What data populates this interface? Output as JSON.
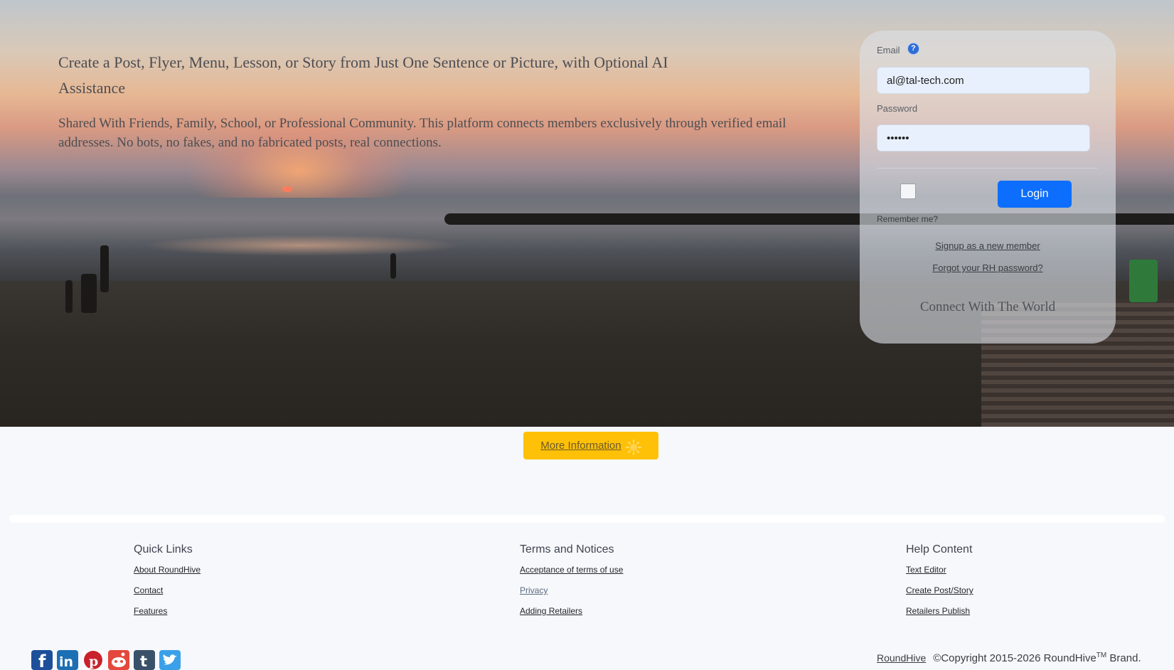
{
  "hero": {
    "title": "Create a Post, Flyer, Menu, Lesson, or Story from Just One Sentence or Picture, with Optional AI Assistance",
    "subtitle": "Shared With Friends, Family, School, or Professional Community. This platform connects members exclusively through verified email addresses. No bots, no fakes, and no fabricated posts, real connections."
  },
  "login": {
    "email_label": "Email",
    "email_help_icon": "help-icon",
    "email_value": "al@tal-tech.com",
    "password_label": "Password",
    "password_value": "••••••",
    "remember_label": "Remember me?",
    "remember_checked": false,
    "login_button": "Login",
    "signup_link": "Signup as a new member",
    "forgot_link": "Forgot your RH password?",
    "tagline": "Connect With The World"
  },
  "more_info": {
    "label": "More Information",
    "icon": "sun-icon"
  },
  "footer": {
    "quick_links": {
      "heading": "Quick Links",
      "items": [
        "About RoundHive",
        "Contact",
        "Features"
      ]
    },
    "terms": {
      "heading": "Terms and Notices",
      "items": [
        "Acceptance of terms of use",
        "Privacy",
        "Adding Retailers"
      ]
    },
    "help": {
      "heading": "Help Content",
      "items": [
        "Text Editor",
        "Create Post/Story",
        "Retailers Publish"
      ]
    },
    "social_icons": [
      "facebook-icon",
      "linkedin-icon",
      "pinterest-icon",
      "reddit-icon",
      "tumblr-icon",
      "twitter-icon"
    ],
    "brand_link": "RoundHive",
    "copyright_text": "©Copyright 2015-2026 RoundHive",
    "trademark": "TM",
    "copyright_suffix": " Brand."
  },
  "colors": {
    "primary": "#0d6efd",
    "warning": "#ffc107",
    "page_bg": "#f6f8fb"
  }
}
